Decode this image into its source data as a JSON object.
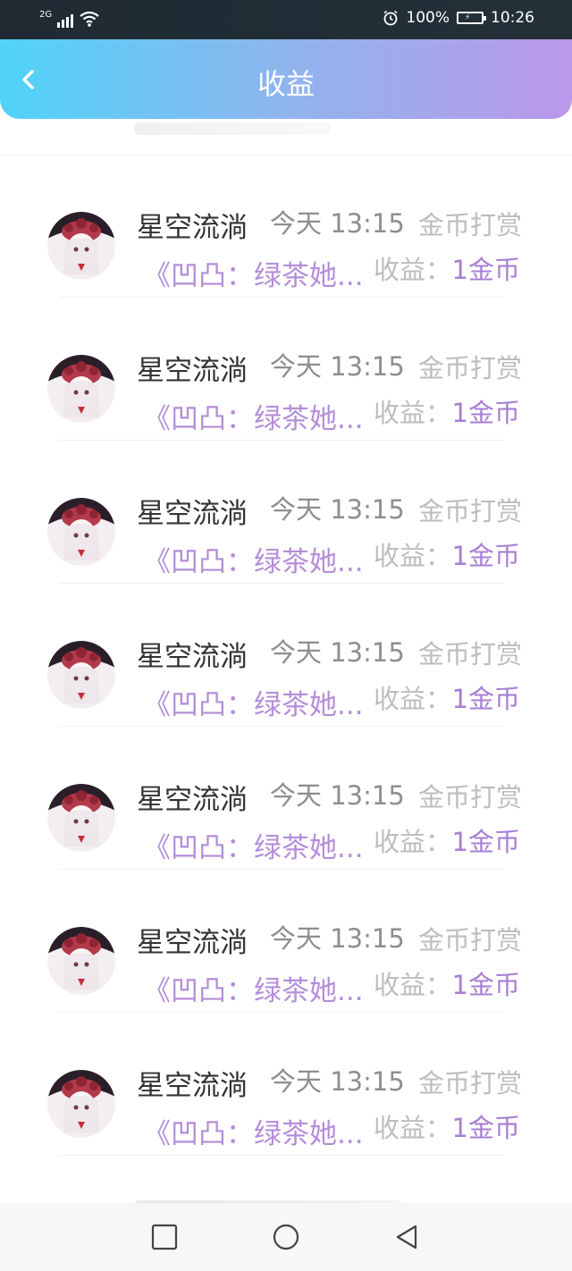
{
  "status_bar": {
    "network_type": "2G",
    "battery": "100%",
    "time": "10:26",
    "icons": [
      "signal-icon",
      "wifi-icon",
      "alarm-icon",
      "battery-icon"
    ]
  },
  "header": {
    "title": "收益",
    "back_icon": "chevron-left-icon",
    "gradient": [
      "#4fd3f7",
      "#8fb4ee",
      "#bb98ea"
    ]
  },
  "records": [
    {
      "name": "星空流淌",
      "time": "今天 13:15",
      "type": "金币打赏",
      "book": "《凹凸：绿茶她...",
      "earn_label": "收益：",
      "earn_value": "1金币"
    },
    {
      "name": "星空流淌",
      "time": "今天 13:15",
      "type": "金币打赏",
      "book": "《凹凸：绿茶她...",
      "earn_label": "收益：",
      "earn_value": "1金币"
    },
    {
      "name": "星空流淌",
      "time": "今天 13:15",
      "type": "金币打赏",
      "book": "《凹凸：绿茶她...",
      "earn_label": "收益：",
      "earn_value": "1金币"
    },
    {
      "name": "星空流淌",
      "time": "今天 13:15",
      "type": "金币打赏",
      "book": "《凹凸：绿茶她...",
      "earn_label": "收益：",
      "earn_value": "1金币"
    },
    {
      "name": "星空流淌",
      "time": "今天 13:15",
      "type": "金币打赏",
      "book": "《凹凸：绿茶她...",
      "earn_label": "收益：",
      "earn_value": "1金币"
    },
    {
      "name": "星空流淌",
      "time": "今天 13:15",
      "type": "金币打赏",
      "book": "《凹凸：绿茶她...",
      "earn_label": "收益：",
      "earn_value": "1金币"
    },
    {
      "name": "星空流淌",
      "time": "今天 13:15",
      "type": "金币打赏",
      "book": "《凹凸：绿茶她...",
      "earn_label": "收益：",
      "earn_value": "1金币"
    }
  ],
  "colors": {
    "name": "#333333",
    "time": "#8e8e8e",
    "muted": "#bdbdbd",
    "accent_purple": "#b48ed8"
  },
  "nav_bar": {
    "buttons": [
      "recent-apps-icon",
      "home-icon",
      "back-triangle-icon"
    ]
  }
}
